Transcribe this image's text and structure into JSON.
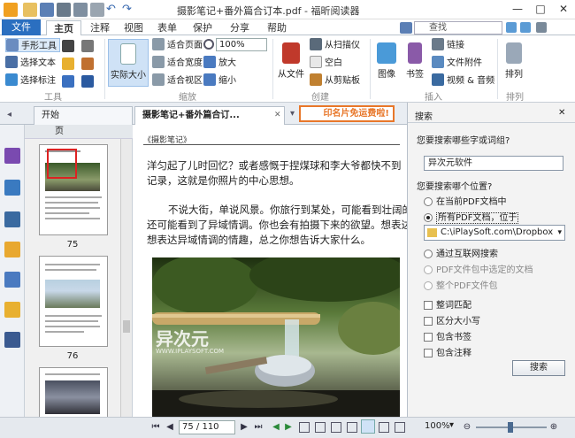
{
  "window": {
    "title": "摄影笔记+番外篇合订本.pdf - 福昕阅读器",
    "min": "—",
    "max": "□",
    "close": "✕"
  },
  "tabs": [
    "文件",
    "主页",
    "注释",
    "视图",
    "表单",
    "保护",
    "分享",
    "帮助"
  ],
  "search_placeholder": "查找",
  "ribbon": {
    "tools": [
      "手形工具",
      "选择文本",
      "选择标注"
    ],
    "tools_label": "工具",
    "actual_size": "实际大小",
    "zoom_items": [
      "适合页面",
      "适合宽度",
      "适合视区"
    ],
    "zoom_value": "100%",
    "zoom_in": "放大",
    "zoom_out": "缩小",
    "zoom_label": "缩放",
    "from_file": "从文件",
    "from_scanner": "从扫描仪",
    "blank": "空白",
    "from_clipboard": "从剪贴板",
    "create_label": "创建",
    "image": "图像",
    "bookmark": "书签",
    "link": "链接",
    "file_attach": "文件附件",
    "video_audio": "视频 & 音频",
    "insert_label": "插入",
    "arrange": "排列",
    "arrange_label": "排列"
  },
  "doctabs": {
    "start": "开始",
    "current": "摄影笔记+番外篇合订...",
    "banner": "印名片免运费啦!"
  },
  "thumbs": {
    "header": "页",
    "pages": [
      "75",
      "76"
    ]
  },
  "doc": {
    "header": "《摄影笔记》",
    "para1": [
      "洋匀起了儿时回忆？或者感慨于捏煤球和李大爷都快不到",
      "记录，这就是你照片的中心思想。"
    ],
    "para2": [
      "不说大街，单说风景。你旅行到某处，可能看到壮阔的",
      "还可能看到了异域情调。你也会有拍摄下来的欲望。想表达大",
      "想表达异域情调的情趣，总之你想告诉大家什么。"
    ],
    "watermark": "异次元",
    "watermark_url": "WWW.IPLAYSOFT.COM"
  },
  "searchpane": {
    "title": "搜索",
    "q1": "您要搜索哪些字或词组?",
    "query": "异次元软件",
    "q2": "您要搜索哪个位置?",
    "opt_current": "在当前PDF文档中",
    "opt_all": "所有PDF文档，位于",
    "folder": "C:\\iPlaySoft.com\\Dropbox",
    "opt_internet": "通过互联网搜索",
    "opt_pkg_sel": "PDF文件包中选定的文档",
    "opt_pkg_all": "整个PDF文件包",
    "chk_whole": "整词匹配",
    "chk_case": "区分大小写",
    "chk_bookmarks": "包含书签",
    "chk_comments": "包含注释",
    "search_btn": "搜索"
  },
  "status": {
    "page": "75 / 110",
    "zoom": "100%"
  },
  "colors": {
    "accent": "#2b6fc0",
    "banner": "#e8772a"
  }
}
